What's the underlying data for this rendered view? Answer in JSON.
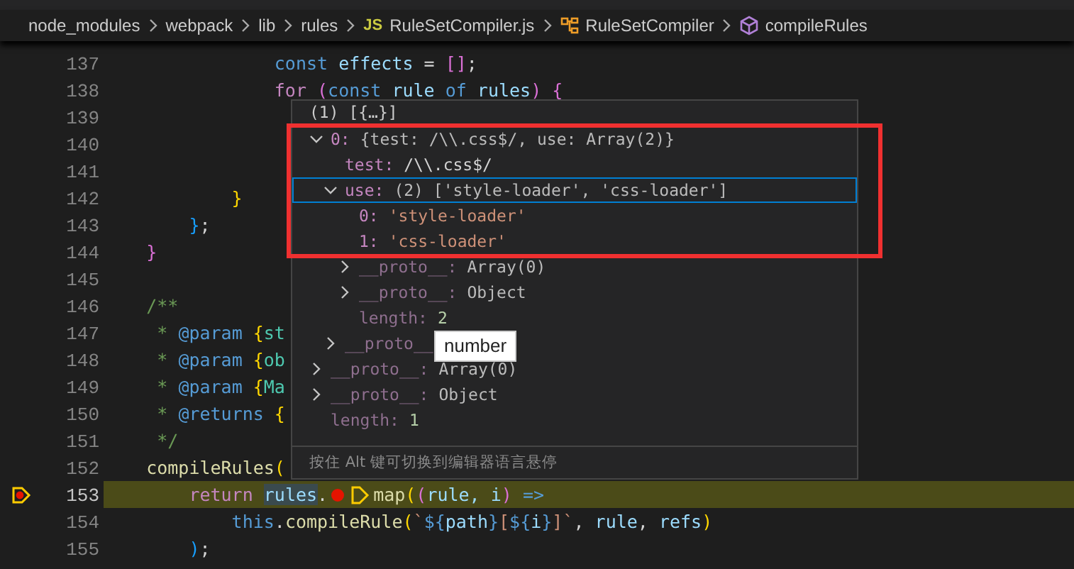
{
  "breadcrumb": [
    {
      "kind": "folder",
      "label": "node_modules"
    },
    {
      "kind": "folder",
      "label": "webpack"
    },
    {
      "kind": "folder",
      "label": "lib"
    },
    {
      "kind": "folder",
      "label": "rules"
    },
    {
      "kind": "file",
      "badge": "JS",
      "label": "RuleSetCompiler.js"
    },
    {
      "kind": "class",
      "label": "RuleSetCompiler"
    },
    {
      "kind": "method",
      "label": "compileRules"
    }
  ],
  "code_lines": [
    {
      "number": "137",
      "current": false,
      "parts": [
        {
          "kind": "code",
          "tokens": [
            {
              "t": "                const ",
              "kind": "kw"
            },
            {
              "t": "effects",
              "kind": "var"
            },
            {
              "t": " = ",
              "kind": "punc"
            },
            {
              "t": "[]",
              "kind": "b2"
            },
            {
              "t": ";",
              "kind": "punc"
            }
          ]
        }
      ]
    },
    {
      "number": "138",
      "current": false,
      "parts": [
        {
          "kind": "code",
          "tokens": [
            {
              "t": "                for ",
              "kind": "ctl"
            },
            {
              "t": "(",
              "kind": "b2"
            },
            {
              "t": "const ",
              "kind": "kw"
            },
            {
              "t": "rule ",
              "kind": "var"
            },
            {
              "t": "of ",
              "kind": "kw"
            },
            {
              "t": "rules",
              "kind": "var"
            },
            {
              "t": ") {",
              "kind": "b2"
            }
          ]
        }
      ]
    },
    {
      "number": "139",
      "current": false
    },
    {
      "number": "140",
      "current": false
    },
    {
      "number": "141",
      "current": false
    },
    {
      "number": "142",
      "current": false,
      "parts": [
        {
          "kind": "code",
          "tokens": [
            {
              "t": "            }",
              "kind": "b1"
            }
          ]
        }
      ]
    },
    {
      "number": "143",
      "current": false,
      "parts": [
        {
          "kind": "code",
          "tokens": [
            {
              "t": "        }",
              "kind": "b3"
            },
            {
              "t": ";",
              "kind": "punc"
            }
          ]
        }
      ]
    },
    {
      "number": "144",
      "current": false,
      "parts": [
        {
          "kind": "code",
          "tokens": [
            {
              "t": "    }",
              "kind": "b2"
            }
          ]
        }
      ]
    },
    {
      "number": "145",
      "current": false
    },
    {
      "number": "146",
      "current": false,
      "parts": [
        {
          "kind": "code",
          "tokens": [
            {
              "t": "    /**",
              "kind": "cmt"
            }
          ]
        }
      ]
    },
    {
      "number": "147",
      "current": false,
      "parts": [
        {
          "kind": "code",
          "tokens": [
            {
              "t": "     * ",
              "kind": "cmt"
            },
            {
              "t": "@param ",
              "kind": "kw"
            },
            {
              "t": "{",
              "kind": "b1"
            },
            {
              "t": "st",
              "kind": "type"
            }
          ]
        }
      ]
    },
    {
      "number": "148",
      "current": false,
      "parts": [
        {
          "kind": "code",
          "tokens": [
            {
              "t": "     * ",
              "kind": "cmt"
            },
            {
              "t": "@param ",
              "kind": "kw"
            },
            {
              "t": "{",
              "kind": "b1"
            },
            {
              "t": "ob",
              "kind": "type"
            }
          ]
        }
      ]
    },
    {
      "number": "149",
      "current": false,
      "parts": [
        {
          "kind": "code",
          "tokens": [
            {
              "t": "     * ",
              "kind": "cmt"
            },
            {
              "t": "@param ",
              "kind": "kw"
            },
            {
              "t": "{",
              "kind": "b1"
            },
            {
              "t": "Ma",
              "kind": "type"
            }
          ]
        }
      ]
    },
    {
      "number": "150",
      "current": false,
      "parts": [
        {
          "kind": "code",
          "tokens": [
            {
              "t": "     * ",
              "kind": "cmt"
            },
            {
              "t": "@returns ",
              "kind": "kw"
            },
            {
              "t": "{",
              "kind": "b1"
            }
          ]
        }
      ]
    },
    {
      "number": "151",
      "current": false,
      "parts": [
        {
          "kind": "code",
          "tokens": [
            {
              "t": "     */",
              "kind": "cmt"
            }
          ]
        }
      ]
    },
    {
      "number": "152",
      "current": false,
      "parts": [
        {
          "kind": "code",
          "tokens": [
            {
              "t": "    compileRules",
              "kind": "fn"
            },
            {
              "t": "(",
              "kind": "b1"
            }
          ]
        }
      ]
    },
    {
      "number": "153",
      "current": true,
      "parts": [
        {
          "kind": "code",
          "tokens": [
            {
              "t": "        return ",
              "kind": "ctl"
            },
            {
              "t": "rules",
              "kind": "hl"
            },
            {
              "t": ".",
              "kind": "punc"
            }
          ]
        },
        {
          "kind": "breakpoint"
        },
        {
          "kind": "step"
        },
        {
          "kind": "code",
          "tokens": [
            {
              "t": "map",
              "kind": "fn"
            },
            {
              "t": "(",
              "kind": "b1"
            },
            {
              "t": "(",
              "kind": "b2"
            },
            {
              "t": "rule, i",
              "kind": "var"
            },
            {
              "t": ")",
              "kind": "b2"
            },
            {
              "t": " =>",
              "kind": "kw"
            }
          ]
        }
      ]
    },
    {
      "number": "154",
      "current": false,
      "parts": [
        {
          "kind": "code",
          "tokens": [
            {
              "t": "            this",
              "kind": "kw"
            },
            {
              "t": ".",
              "kind": "punc"
            },
            {
              "t": "compileRule",
              "kind": "fn"
            },
            {
              "t": "(",
              "kind": "b1"
            },
            {
              "t": "`",
              "kind": "str"
            },
            {
              "t": "${",
              "kind": "kw"
            },
            {
              "t": "path",
              "kind": "var"
            },
            {
              "t": "}",
              "kind": "kw"
            },
            {
              "t": "[",
              "kind": "str"
            },
            {
              "t": "${",
              "kind": "kw"
            },
            {
              "t": "i",
              "kind": "var"
            },
            {
              "t": "}",
              "kind": "kw"
            },
            {
              "t": "]`",
              "kind": "str"
            },
            {
              "t": ", ",
              "kind": "punc"
            },
            {
              "t": "rule",
              "kind": "var"
            },
            {
              "t": ", ",
              "kind": "punc"
            },
            {
              "t": "refs",
              "kind": "var"
            },
            {
              "t": ")",
              "kind": "b1"
            }
          ]
        }
      ]
    },
    {
      "number": "155",
      "current": false,
      "parts": [
        {
          "kind": "code",
          "tokens": [
            {
              "t": "        )",
              "kind": "b3"
            },
            {
              "t": ";",
              "kind": "punc"
            }
          ]
        }
      ]
    }
  ],
  "hover_popup": {
    "header": "(1) [{…}]",
    "nodes": [
      {
        "key": "0:",
        "value": "{test: /\\\\.css$/, use: Array(2)}",
        "kind": "object",
        "internal": false,
        "expanded": true,
        "selected": false,
        "children": [
          {
            "key": "test:",
            "value": "/\\\\.css$/",
            "kind": "regex",
            "internal": false,
            "selected": false
          },
          {
            "key": "use:",
            "value": "(2) ['style-loader', 'css-loader']",
            "kind": "object",
            "internal": false,
            "expanded": true,
            "selected": true,
            "children": [
              {
                "key": "0:",
                "value": "'style-loader'",
                "kind": "string",
                "internal": false,
                "selected": false
              },
              {
                "key": "1:",
                "value": "'css-loader'",
                "kind": "string",
                "internal": false,
                "selected": false
              },
              {
                "key": "__proto__:",
                "value": "Array(0)",
                "kind": "object",
                "internal": true,
                "expanded": false,
                "selected": false
              },
              {
                "key": "__proto__:",
                "value": "Object",
                "kind": "object",
                "internal": true,
                "expanded": false,
                "selected": false
              },
              {
                "key": "length:",
                "value": "2",
                "kind": "number",
                "internal": true,
                "selected": false
              }
            ]
          },
          {
            "key": "__proto__",
            "internal": true,
            "expanded": false,
            "selected": false
          }
        ]
      },
      {
        "key": "__proto__:",
        "value": "Array(0)",
        "kind": "object",
        "internal": true,
        "expanded": false,
        "selected": false
      },
      {
        "key": "__proto__:",
        "value": "Object",
        "kind": "object",
        "internal": true,
        "expanded": false,
        "selected": false
      },
      {
        "key": "length:",
        "value": "1",
        "kind": "number",
        "internal": true,
        "selected": false
      }
    ],
    "hint": "按住 Alt 键可切换到编辑器语言悬停"
  },
  "type_tooltip": "number"
}
